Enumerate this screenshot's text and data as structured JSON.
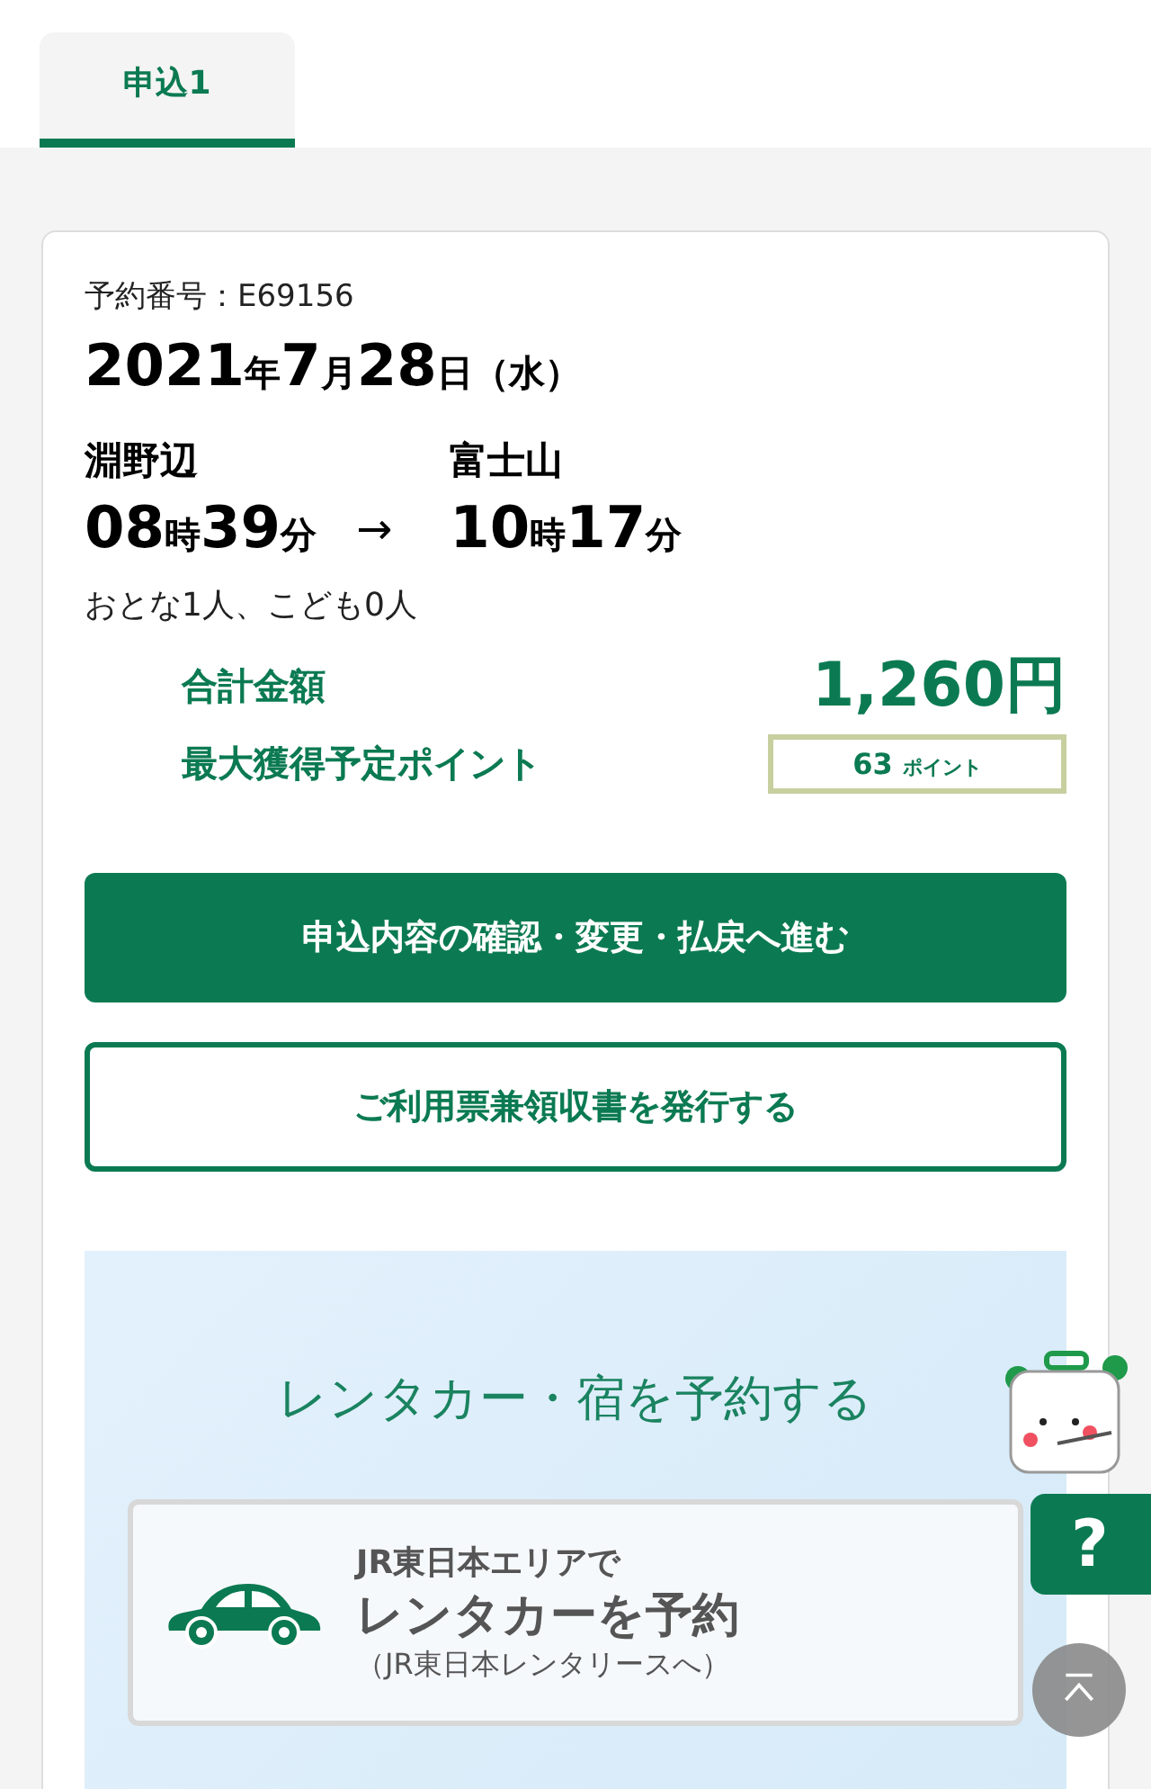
{
  "tabs": [
    {
      "label": "申込1",
      "selected": true
    }
  ],
  "reservation": {
    "number_label": "予約番号：E69156",
    "date": {
      "year": "2021",
      "year_unit": "年",
      "month": "7",
      "month_unit": "月",
      "day": "28",
      "day_unit": "日",
      "weekday": "（水）"
    },
    "departure": {
      "station": "淵野辺",
      "hour": "08",
      "hour_unit": "時",
      "minute": "39",
      "minute_unit": "分"
    },
    "arrow": "→",
    "arrival": {
      "station": "富士山",
      "hour": "10",
      "hour_unit": "時",
      "minute": "17",
      "minute_unit": "分"
    },
    "passengers": "おとな1人、こども0人",
    "total_label": "合計金額",
    "total_value": "1,260円",
    "points_label": "最大獲得予定ポイント",
    "points_value": "63",
    "points_unit": "ポイント"
  },
  "buttons": [
    {
      "kind": "primary",
      "label": "申込内容の確認・変更・払戻へ進む"
    },
    {
      "kind": "outline",
      "label": "ご利用票兼領収書を発行する"
    }
  ],
  "promo": {
    "title": "レンタカー・宿を予約する",
    "card": {
      "subtitle": "JR東日本エリアで",
      "title": "レンタカーを予約",
      "note": "（JR東日本レンタリースへ）"
    }
  },
  "help_button": {
    "label": "?"
  }
}
